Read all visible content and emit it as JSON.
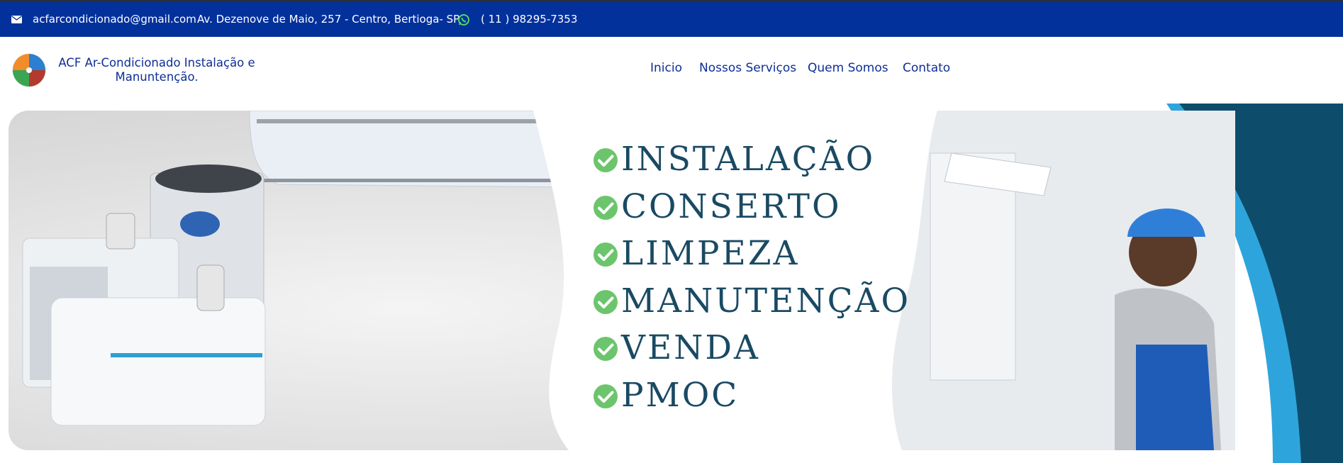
{
  "topbar": {
    "email": "acfarcondicionado@gmail.com",
    "address": "Av. Dezenove de Maio, 257 - Centro, Bertioga- SP",
    "phone": "( 11 ) 98295-7353"
  },
  "header": {
    "brand": "ACF Ar-Condicionado Instalação e Manuntenção.",
    "nav": [
      "Inicio",
      "Nossos Serviços",
      "Quem Somos",
      "Contato"
    ]
  },
  "banner": {
    "services": [
      "INSTALAÇÃO",
      "CONSERTO",
      "LIMPEZA",
      "MANUTENÇÃO",
      "VENDA",
      "PMOC"
    ]
  },
  "colors": {
    "topbar": "#03319b",
    "nav_text": "#0f2e96",
    "service_text": "#1a4a63",
    "check_green": "#6cc56c",
    "deco_dark": "#0d4d6b",
    "deco_light": "#2ea4dc"
  },
  "icons": [
    "envelope-icon",
    "whatsapp-icon",
    "check-circle-icon"
  ]
}
